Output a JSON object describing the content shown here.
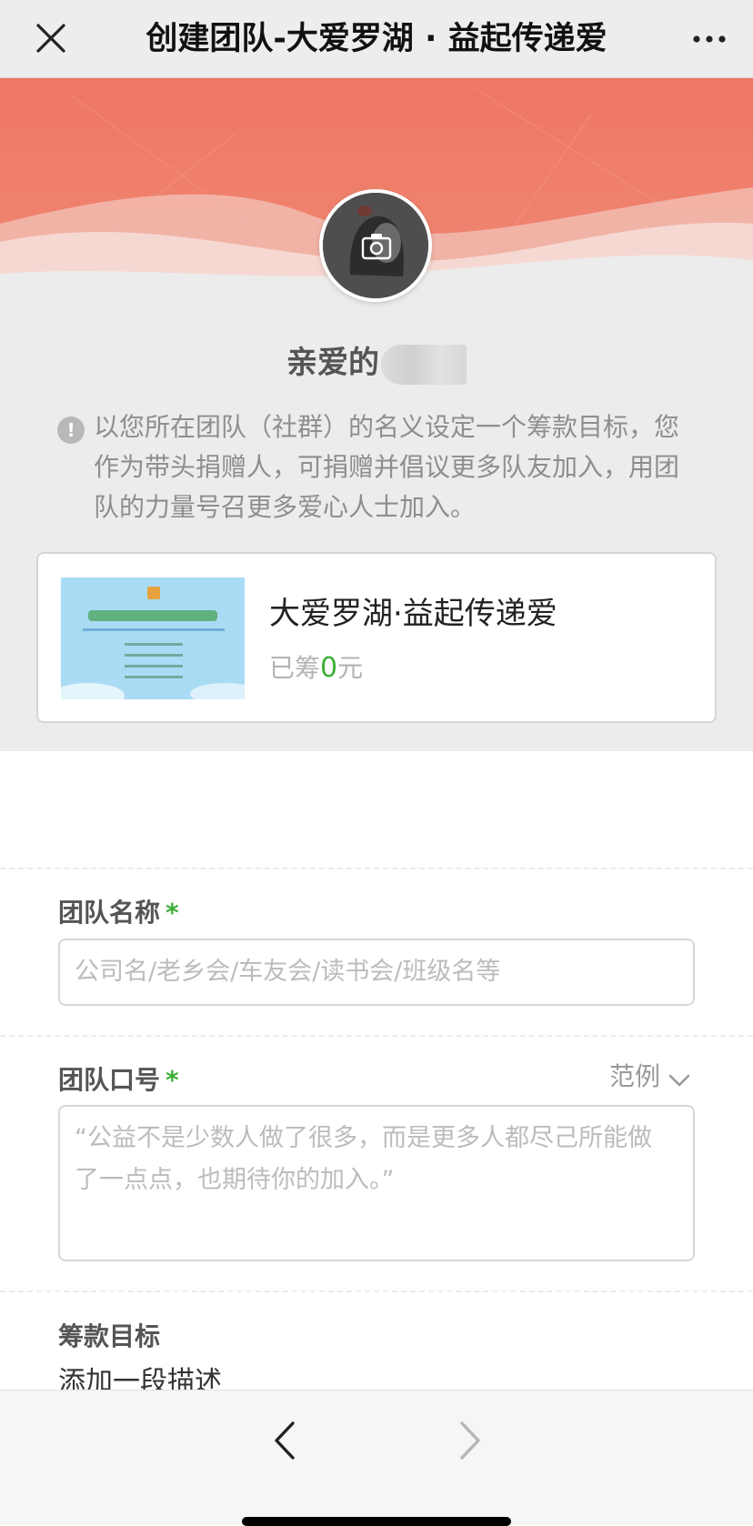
{
  "navbar": {
    "title": "创建团队-大爱罗湖 · 益起传递爱",
    "close_icon": "close-icon",
    "more_icon": "more-icon"
  },
  "header": {
    "greeting": "亲爱的",
    "banner_color": "#ee7c68"
  },
  "notice": {
    "text": "以您所在团队（社群）的名义设定一个筹款目标，您作为带头捐赠人，可捐赠并倡议更多队友加入，用团队的力量号召更多爱心人士加入。"
  },
  "project": {
    "title": "大爱罗湖·益起传递爱",
    "raised_prefix": "已筹",
    "raised_amount": "0",
    "raised_unit": "元",
    "amount_color": "#3cb035"
  },
  "form": {
    "team_name": {
      "label": "团队名称",
      "required_mark": "*",
      "placeholder": "公司名/老乡会/车友会/读书会/班级名等"
    },
    "team_slogan": {
      "label": "团队口号",
      "required_mark": "*",
      "example_label": "范例",
      "placeholder": "“公益不是少数人做了很多，而是更多人都尽己所能做了一点点，也期待你的加入。”"
    },
    "goal": {
      "label": "筹款目标",
      "description": "添加一段描述"
    }
  },
  "toolbar": {
    "back_icon": "back-arrow-icon",
    "forward_icon": "forward-arrow-icon"
  }
}
